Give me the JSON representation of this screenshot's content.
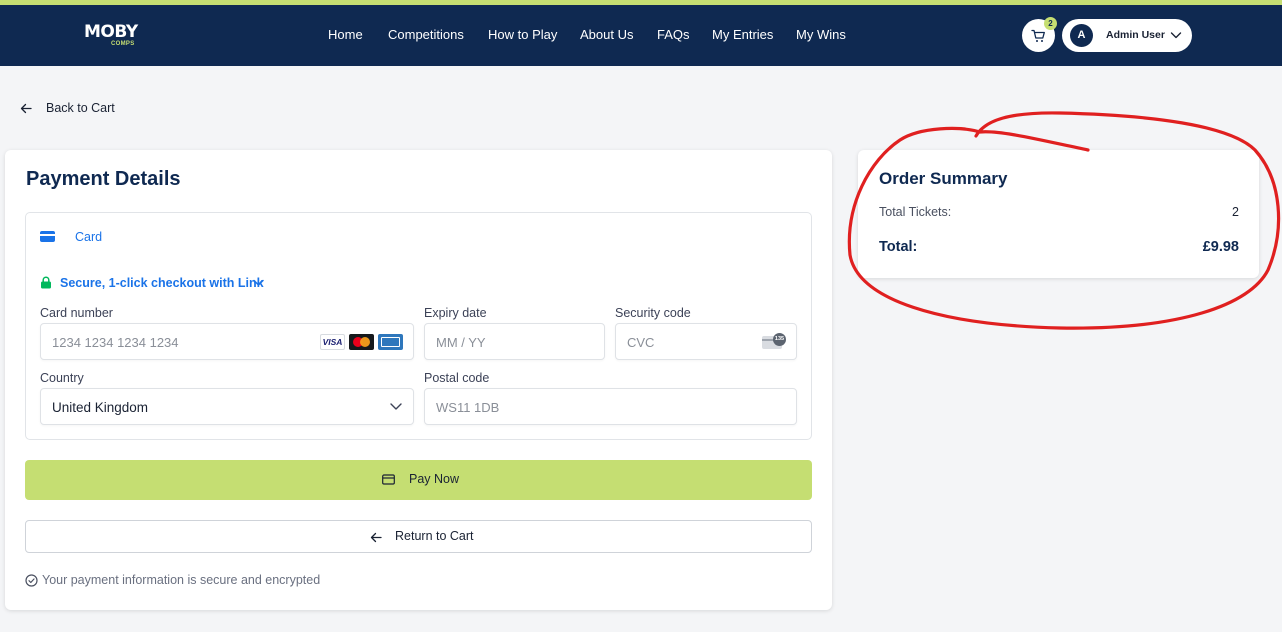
{
  "brand": {
    "logo_main": "MOBY",
    "logo_sub": "COMPS"
  },
  "nav": {
    "items": [
      {
        "label": "Home"
      },
      {
        "label": "Competitions"
      },
      {
        "label": "How to Play"
      },
      {
        "label": "About Us"
      },
      {
        "label": "FAQs"
      },
      {
        "label": "My Entries"
      },
      {
        "label": "My Wins"
      }
    ],
    "cart_count": "2",
    "user_initial": "A",
    "user_name": "Admin User"
  },
  "back_link": {
    "label": "Back to Cart"
  },
  "payment": {
    "title": "Payment Details",
    "tab_label": "Card",
    "link_label": "Secure, 1-click checkout with Link",
    "card_number": {
      "label": "Card number",
      "placeholder": "1234 1234 1234 1234"
    },
    "card_brands": {
      "visa": "VISA"
    },
    "expiry": {
      "label": "Expiry date",
      "placeholder": "MM / YY"
    },
    "security": {
      "label": "Security code",
      "placeholder": "CVC",
      "icon_text": "135"
    },
    "country": {
      "label": "Country",
      "value": "United Kingdom"
    },
    "postal": {
      "label": "Postal code",
      "placeholder": "WS11 1DB"
    },
    "pay_button": "Pay Now",
    "return_button": "Return to Cart",
    "secure_note": "Your payment information is secure and encrypted"
  },
  "summary": {
    "title": "Order Summary",
    "tickets_label": "Total Tickets:",
    "tickets_value": "2",
    "total_label": "Total:",
    "total_value": "£9.98"
  },
  "colors": {
    "navbar": "#0f2951",
    "accent": "#c5de72",
    "link_blue": "#1a73e8",
    "annotation_red": "#e02020"
  }
}
